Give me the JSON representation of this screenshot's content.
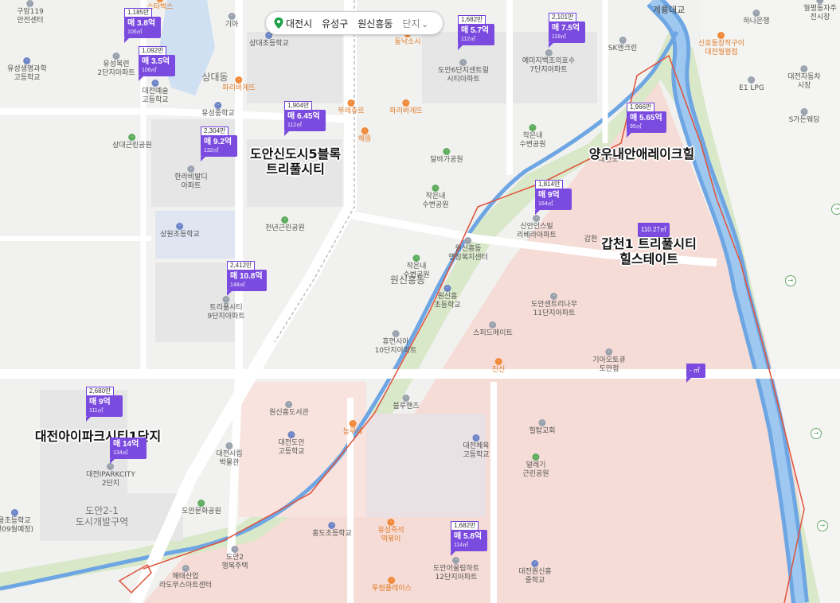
{
  "search_bar": {
    "location_icon": "map-pin-icon",
    "city": "대전시",
    "district": "유성구",
    "dong": "원신흥동",
    "filter": "단지",
    "filter_icon": "chevron-down-icon"
  },
  "colors": {
    "marker": "#7b4be0",
    "boundary": "#e0523a",
    "river": "#4a90e2",
    "park": "#d9e8c8",
    "residential": "#f6dcd6"
  },
  "markers": [
    {
      "units": "1,185만",
      "price": "매 3.8억",
      "area": "106㎡"
    },
    {
      "units": "1,092만",
      "price": "매 3.5억",
      "area": "106㎡"
    },
    {
      "units": "2,304만",
      "price": "매 9.2억",
      "area": "132㎡"
    },
    {
      "units": "1,904만",
      "price": "매 6.45억",
      "area": "112㎡"
    },
    {
      "units": "1,682만",
      "price": "매 5.7억",
      "area": "112㎡"
    },
    {
      "units": "2,101만",
      "price": "매 7.5억",
      "area": "118㎡"
    },
    {
      "units": "1,966만",
      "price": "매 5.65억",
      "area": "95㎡"
    },
    {
      "units": "1,814만",
      "price": "매 9억",
      "area": "164㎡"
    },
    {
      "units": "",
      "price": "110.27㎡",
      "area": ""
    },
    {
      "units": "2,412만",
      "price": "매 10.8억",
      "area": "148㎡"
    },
    {
      "units": "",
      "price": "- ㎡",
      "area": ""
    },
    {
      "units": "2,680만",
      "price": "매 9억",
      "area": "111㎡"
    },
    {
      "units": "",
      "price": "매 14억",
      "area": "134㎡"
    },
    {
      "units": "1,682만",
      "price": "매 5.8억",
      "area": "114㎡"
    }
  ],
  "big_labels": {
    "doan5": "도안신도시5블록\n트리풀시티",
    "yangu": "양우내안애레이크힐",
    "gapcheon": "갑천1 트리풀시티\n힐스테이트",
    "ipark": "대전아이파크시티1단지"
  },
  "district_labels": {
    "sangdae": "상대동",
    "wonsin": "원신흥동",
    "doan21": "도안2-1\n도시개발구역",
    "gyeryong": "계룡대교"
  },
  "pois": [
    {
      "name": "구암119\n안전센터",
      "type": "gray"
    },
    {
      "name": "스타벅스",
      "type": "orange"
    },
    {
      "name": "기아",
      "type": "gray"
    },
    {
      "name": "상대초등학교",
      "type": "blue"
    },
    {
      "name": "동낙소시",
      "type": "orange"
    },
    {
      "name": "유성생명과학\n고등학교",
      "type": "blue"
    },
    {
      "name": "유성복련\n2단지아파트",
      "type": "gray"
    },
    {
      "name": "대전예술\n고등학교",
      "type": "blue"
    },
    {
      "name": "파리바게뜨",
      "type": "orange"
    },
    {
      "name": "뚜레쥬르",
      "type": "orange"
    },
    {
      "name": "파리바게뜨",
      "type": "orange"
    },
    {
      "name": "유성중학교",
      "type": "blue"
    },
    {
      "name": "상대근린공원",
      "type": "green"
    },
    {
      "name": "해뜸",
      "type": "orange"
    },
    {
      "name": "한라비발디\n아파트",
      "type": "gray"
    },
    {
      "name": "도안6단지센트럴\n시티아파트",
      "type": "gray"
    },
    {
      "name": "예미지백조의호수\n7단지아파트",
      "type": "gray"
    },
    {
      "name": "SK엔크린",
      "type": "gray"
    },
    {
      "name": "하나은행",
      "type": "gray"
    },
    {
      "name": "신호동장작구이\n대전월평점",
      "type": "orange"
    },
    {
      "name": "월평동자주\n전시장",
      "type": "gray"
    },
    {
      "name": "대전자동차\n시장",
      "type": "gray"
    },
    {
      "name": "E1 LPG",
      "type": "gray"
    },
    {
      "name": "S가든웨딩",
      "type": "gray"
    },
    {
      "name": "작은내\n수변공원",
      "type": "green"
    },
    {
      "name": "달바가공원",
      "type": "green"
    },
    {
      "name": "작은내\n수변공원",
      "type": "green"
    },
    {
      "name": "천년근린공원",
      "type": "green"
    },
    {
      "name": "상원초등학교",
      "type": "blue"
    },
    {
      "name": "신안인스빌\n리베라아파트",
      "type": "gray"
    },
    {
      "name": "원신흥동\n행정복지센터",
      "type": "gray"
    },
    {
      "name": "작은내\n수변공원",
      "type": "green"
    },
    {
      "name": "트리풀시티\n9단지아파트",
      "type": "gray"
    },
    {
      "name": "원신흥\n초등학교",
      "type": "blue"
    },
    {
      "name": "도안센트리나무\n11단지아파트",
      "type": "gray"
    },
    {
      "name": "휴먼시아\n10단지아파트",
      "type": "gray"
    },
    {
      "name": "스피드메이트",
      "type": "gray"
    },
    {
      "name": "진신",
      "type": "orange"
    },
    {
      "name": "기아오토큐\n도안점",
      "type": "gray"
    },
    {
      "name": "원신흥도서관",
      "type": "gray"
    },
    {
      "name": "블루핸즈",
      "type": "gray"
    },
    {
      "name": "대전도안\n고등학교",
      "type": "blue"
    },
    {
      "name": "능루네",
      "type": "orange"
    },
    {
      "name": "힐탑교회",
      "type": "gray"
    },
    {
      "name": "대전체육\n고등학교",
      "type": "blue"
    },
    {
      "name": "대전시립\n박물관",
      "type": "gray"
    },
    {
      "name": "대전IPARKCITY\n2단지",
      "type": "gray"
    },
    {
      "name": "덜레기\n근린공원",
      "type": "green"
    },
    {
      "name": "도안문화공원",
      "type": "green"
    },
    {
      "name": "홍도초등학교",
      "type": "blue"
    },
    {
      "name": "유성즉석\n떡볶이",
      "type": "orange"
    },
    {
      "name": "도안어울림하트\n12단지아파트",
      "type": "gray"
    },
    {
      "name": "대전원신흥\n중학교",
      "type": "blue"
    },
    {
      "name": "도안2\n행복주택",
      "type": "gray"
    },
    {
      "name": "해태산업\n라도무스아트센터",
      "type": "gray"
    },
    {
      "name": "투썸플레이스",
      "type": "orange"
    },
    {
      "name": "용초등학교\n년09월예정)",
      "type": "blue"
    },
    {
      "name": "갑천",
      "type": "gray"
    },
    {
      "name": "대전노",
      "type": "gray"
    }
  ]
}
